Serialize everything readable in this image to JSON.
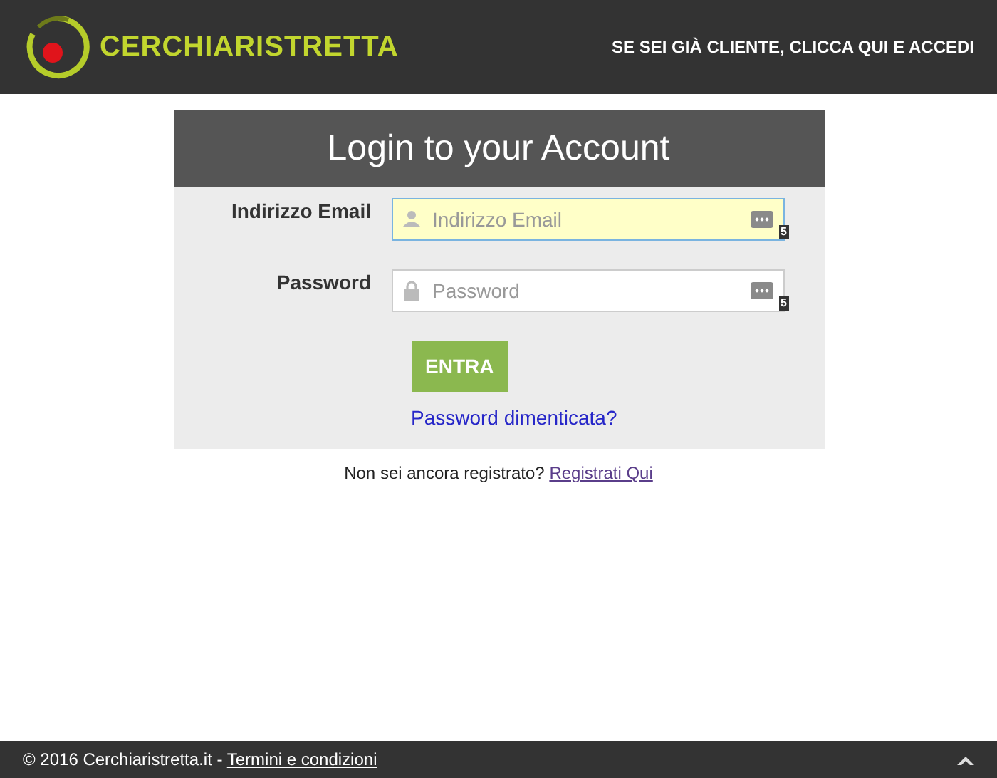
{
  "header": {
    "logo": "CERCHIARISTRETTA",
    "link": "SE SEI GIÀ CLIENTE, CLICCA QUI E ACCEDI"
  },
  "login": {
    "title": "Login to your Account",
    "fields": [
      {
        "kind": "email",
        "label": "Indirizzo Email",
        "placeholder": "Indirizzo Email",
        "focused": true,
        "badge": "5"
      },
      {
        "kind": "password",
        "label": "Password",
        "placeholder": "Password",
        "focused": false,
        "badge": "5"
      }
    ],
    "submit": "ENTRA",
    "forgot": "Password dimenticata?"
  },
  "register": {
    "text": "Non sei ancora registrato?",
    "link": "Registrati Qui"
  },
  "footer": {
    "copyright": "© 2016 Cerchiaristretta.it -",
    "link": "Termini e condizioni"
  }
}
